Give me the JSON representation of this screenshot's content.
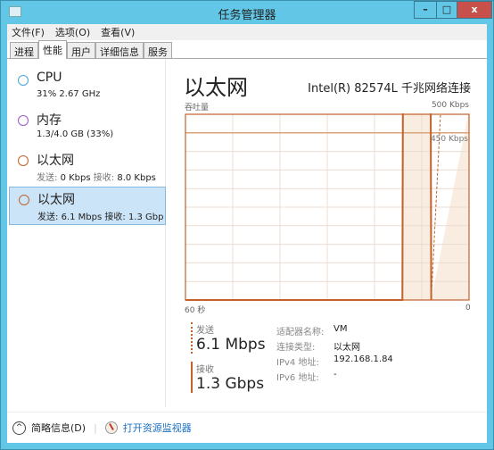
{
  "window": {
    "title": "任务管理器",
    "minimize": "–",
    "maximize": "□",
    "close": "x"
  },
  "menu": [
    "文件(F)",
    "选项(O)",
    "查看(V)"
  ],
  "tabs": [
    {
      "label": "进程"
    },
    {
      "label": "性能",
      "active": true
    },
    {
      "label": "用户"
    },
    {
      "label": "详细信息"
    },
    {
      "label": "服务"
    }
  ],
  "sidebar": [
    {
      "name": "CPU",
      "sub": "31% 2.67 GHz",
      "color": "#4aa3d8"
    },
    {
      "name": "内存",
      "sub": "1.3/4.0 GB (33%)",
      "color": "#9b59c9"
    },
    {
      "name": "以太网",
      "send_label": "发送:",
      "send": "0 Kbps",
      "recv_label": "接收:",
      "recv": "8.0 Kbps",
      "color": "#c0622a"
    },
    {
      "name": "以太网",
      "send_label": "发送:",
      "send": "6.1 Mbps",
      "recv_label": "接收:",
      "recv": "1.3 Gbp",
      "color": "#c0622a",
      "selected": true
    }
  ],
  "main": {
    "title": "以太网",
    "adapter": "Intel(R) 82574L 千兆网络连接",
    "send_label": "发送",
    "send_value": "6.1 Mbps",
    "recv_label": "接收",
    "recv_value": "1.3 Gbps",
    "details": [
      {
        "k": "适配器名称:",
        "v": "VM"
      },
      {
        "k": "连接类型:",
        "v": "以太网"
      },
      {
        "k": "IPv4 地址:",
        "v": "192.168.1.84"
      },
      {
        "k": "IPv6 地址:",
        "v": "-"
      }
    ]
  },
  "chart_data": {
    "type": "line",
    "ylabel": "吞吐量",
    "ymax_label": "500 Kbps",
    "ref_label": "450 Kbps",
    "xleft": "60 秒",
    "xright": "0",
    "xlim": [
      60,
      0
    ],
    "ylim": [
      0,
      500
    ],
    "ref_value": 450,
    "grid": true,
    "color": "#c0622a",
    "series": [
      {
        "style": "solid",
        "points": [
          [
            60,
            0
          ],
          [
            14.1,
            0
          ],
          [
            14,
            1300000
          ],
          [
            8.1,
            1300000
          ],
          [
            8,
            0
          ]
        ]
      },
      {
        "style": "dashed",
        "points": [
          [
            60,
            0
          ],
          [
            8,
            0
          ],
          [
            6,
            6100
          ]
        ]
      }
    ]
  },
  "footer": {
    "fewer": "简略信息(D)",
    "open_monitor": "打开资源监视器"
  }
}
